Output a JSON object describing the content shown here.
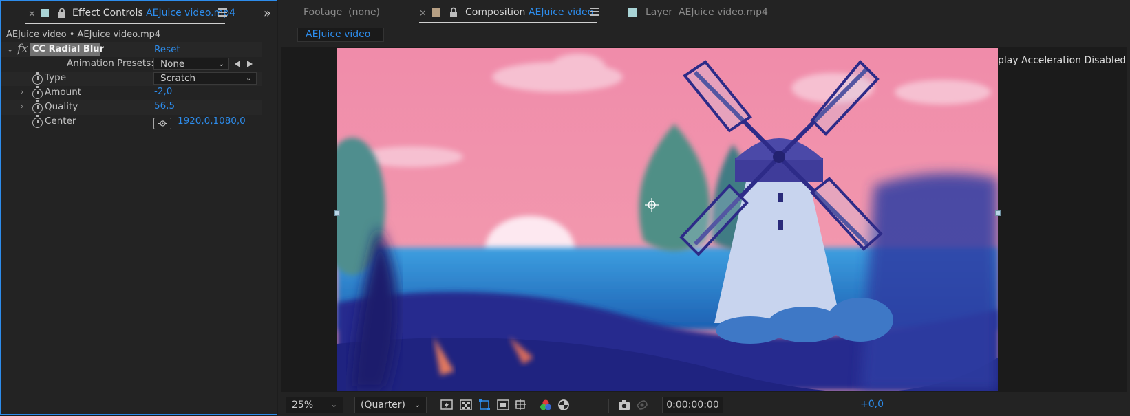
{
  "effect_controls": {
    "tab_label": "Effect Controls",
    "tab_target": "AEJuice video.mp4",
    "layer_path": "AEJuice video • AEJuice video.mp4",
    "effect": {
      "fx_symbol": "fx",
      "name": "CC Radial Blur",
      "reset_label": "Reset",
      "presets_label": "Animation Presets:",
      "presets_value": "None",
      "properties": [
        {
          "label": "Type",
          "value": "Scratch"
        },
        {
          "label": "Amount",
          "value": "-2,0"
        },
        {
          "label": "Quality",
          "value": "56,5"
        },
        {
          "label": "Center",
          "value": "1920,0,1080,0"
        }
      ]
    }
  },
  "viewer_tabs": {
    "footage": {
      "label": "Footage",
      "target": "(none)"
    },
    "composition": {
      "label": "Composition",
      "target": "AEJuice video"
    },
    "layer": {
      "label": "Layer",
      "target": "AEJuice video.mp4"
    }
  },
  "comp_subtab": "AEJuice video",
  "accel_notice": "Display Acceleration Disabled",
  "toolbar": {
    "zoom": "25%",
    "resolution": "(Quarter)",
    "exposure": "+0,0",
    "timecode": "0:00:00:00"
  },
  "colors": {
    "accent": "#2d8ceb",
    "panel_bg": "#232323",
    "sky": "#f090a8",
    "water": "#2e7fd0",
    "hills": "#252a8e",
    "windmill_cap": "#3f3c9a",
    "windmill_body": "#c8d4ee"
  },
  "icons": [
    "close-icon",
    "lock-icon",
    "panel-menu-icon",
    "chevron-double-right-icon",
    "stopwatch-icon",
    "target-icon",
    "prev-keyframe-icon",
    "next-keyframe-icon",
    "fast-previews-icon",
    "transparency-grid-icon",
    "mask-visibility-icon",
    "region-of-interest-icon",
    "guides-icon",
    "color-channels-icon",
    "reset-exposure-icon",
    "camera-icon",
    "show-snapshot-icon"
  ]
}
